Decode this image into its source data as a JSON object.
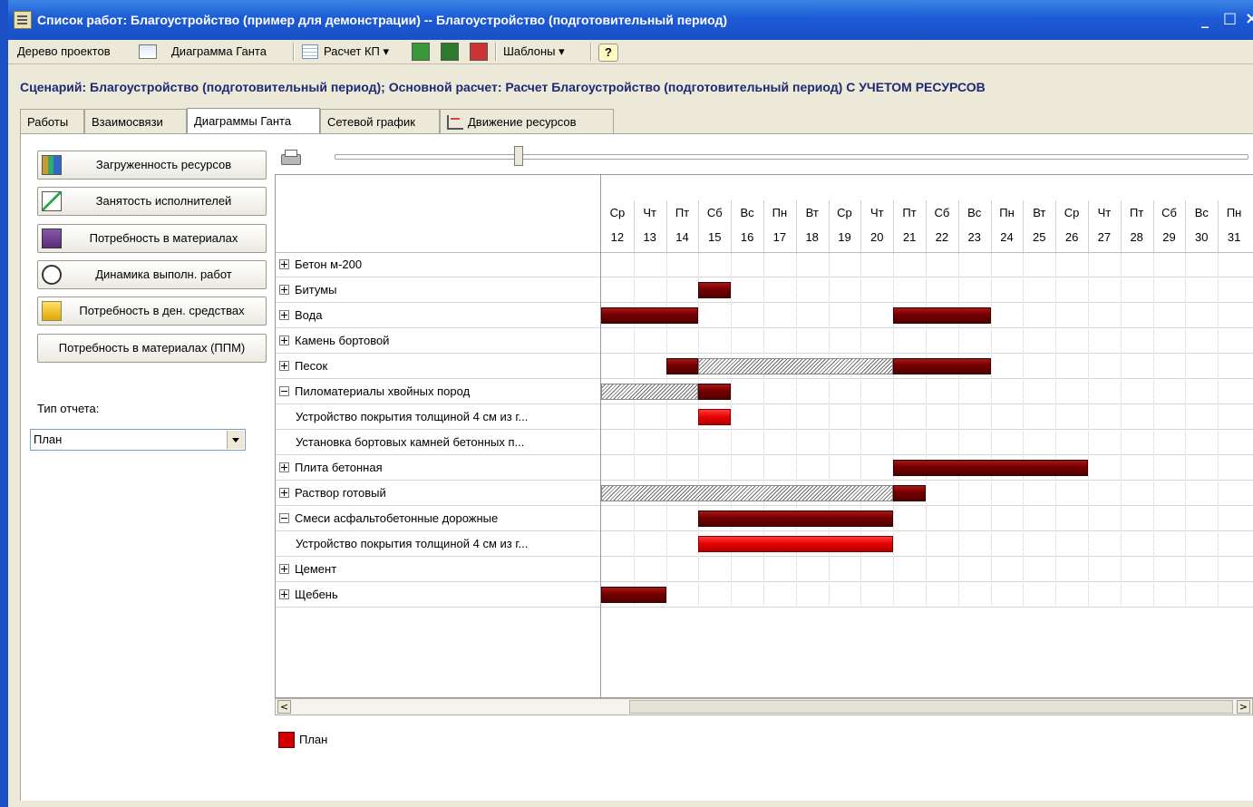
{
  "window": {
    "title": "Список работ: Благоустройство (пример для демонстрации) -- Благоустройство (подготовительный период)",
    "minimize_glyph": "_",
    "maximize_glyph": "□",
    "close_glyph": "×"
  },
  "toolbar": {
    "project_tree": "Дерево проектов",
    "gantt": "Диаграмма Ганта",
    "calc": "Расчет КП ▾",
    "templates": "Шаблоны ▾",
    "help": "?"
  },
  "scenario": "Сценарий: Благоустройство (подготовительный период); Основной расчет: Расчет Благоустройство (подготовительный период) С УЧЕТОМ РЕСУРСОВ",
  "tabs": [
    "Работы",
    "Взаимосвязи",
    "Диаграммы Ганта",
    "Сетевой график",
    "Движение ресурсов"
  ],
  "left_buttons": [
    "Загруженность ресурсов",
    "Занятость исполнителей",
    "Потребность в материалах",
    "Динамика выполн. работ",
    "Потребность в ден. средствах",
    "Потребность в материалах (ППМ)"
  ],
  "report_type": {
    "label": "Тип отчета:",
    "value": "План"
  },
  "chart_data": {
    "type": "gantt",
    "days": [
      {
        "dow": "Ср",
        "dom": "12"
      },
      {
        "dow": "Чт",
        "dom": "13"
      },
      {
        "dow": "Пт",
        "dom": "14"
      },
      {
        "dow": "Сб",
        "dom": "15"
      },
      {
        "dow": "Вс",
        "dom": "16"
      },
      {
        "dow": "Пн",
        "dom": "17"
      },
      {
        "dow": "Вт",
        "dom": "18"
      },
      {
        "dow": "Ср",
        "dom": "19"
      },
      {
        "dow": "Чт",
        "dom": "20"
      },
      {
        "dow": "Пт",
        "dom": "21"
      },
      {
        "dow": "Сб",
        "dom": "22"
      },
      {
        "dow": "Вс",
        "dom": "23"
      },
      {
        "dow": "Пн",
        "dom": "24"
      },
      {
        "dow": "Вт",
        "dom": "25"
      },
      {
        "dow": "Ср",
        "dom": "26"
      },
      {
        "dow": "Чт",
        "dom": "27"
      },
      {
        "dow": "Пт",
        "dom": "28"
      },
      {
        "dow": "Сб",
        "dom": "29"
      },
      {
        "dow": "Вс",
        "dom": "30"
      },
      {
        "dow": "Пн",
        "dom": "31"
      }
    ],
    "rows": [
      {
        "label": "Бетон м-200",
        "level": 0,
        "expander": "plus",
        "bars": []
      },
      {
        "label": "Битумы",
        "level": 0,
        "expander": "plus",
        "bars": [
          {
            "start": "15",
            "end": "15",
            "style": "plan"
          }
        ]
      },
      {
        "label": "Вода",
        "level": 0,
        "expander": "plus",
        "bars": [
          {
            "start": "12",
            "end": "14",
            "style": "plan"
          },
          {
            "start": "21",
            "end": "23",
            "style": "plan"
          }
        ]
      },
      {
        "label": "Камень бортовой",
        "level": 0,
        "expander": "plus",
        "bars": []
      },
      {
        "label": "Песок",
        "level": 0,
        "expander": "plus",
        "bars": [
          {
            "start": "14",
            "end": "14",
            "style": "plan"
          },
          {
            "start": "15",
            "end": "20",
            "style": "hatch"
          },
          {
            "start": "21",
            "end": "23",
            "style": "plan"
          }
        ]
      },
      {
        "label": "Пиломатериалы хвойных пород",
        "level": 0,
        "expander": "minus",
        "bars": [
          {
            "start": "12",
            "end": "14",
            "style": "hatch"
          },
          {
            "start": "15",
            "end": "15",
            "style": "plan"
          }
        ]
      },
      {
        "label": "Устройство покрытия толщиной 4 см из г...",
        "level": 1,
        "expander": "",
        "bars": [
          {
            "start": "15",
            "end": "15",
            "style": "bright"
          }
        ]
      },
      {
        "label": "Установка бортовых камней бетонных п...",
        "level": 1,
        "expander": "",
        "bars": []
      },
      {
        "label": "Плита бетонная",
        "level": 0,
        "expander": "plus",
        "bars": [
          {
            "start": "21",
            "end": "26",
            "style": "plan"
          }
        ]
      },
      {
        "label": "Раствор готовый",
        "level": 0,
        "expander": "plus",
        "bars": [
          {
            "start": "12",
            "end": "20",
            "style": "hatch"
          },
          {
            "start": "21",
            "end": "21",
            "style": "plan"
          }
        ]
      },
      {
        "label": "Смеси асфальтобетонные дорожные",
        "level": 0,
        "expander": "minus",
        "bars": [
          {
            "start": "15",
            "end": "20",
            "style": "plan"
          }
        ]
      },
      {
        "label": "Устройство покрытия толщиной 4 см из г...",
        "level": 1,
        "expander": "",
        "bars": [
          {
            "start": "15",
            "end": "20",
            "style": "bright"
          }
        ]
      },
      {
        "label": "Цемент",
        "level": 0,
        "expander": "plus",
        "bars": []
      },
      {
        "label": "Щебень",
        "level": 0,
        "expander": "plus",
        "bars": [
          {
            "start": "12",
            "end": "13",
            "style": "plan"
          }
        ]
      }
    ],
    "legend": [
      {
        "label": "План",
        "color": "#d10000"
      }
    ]
  }
}
